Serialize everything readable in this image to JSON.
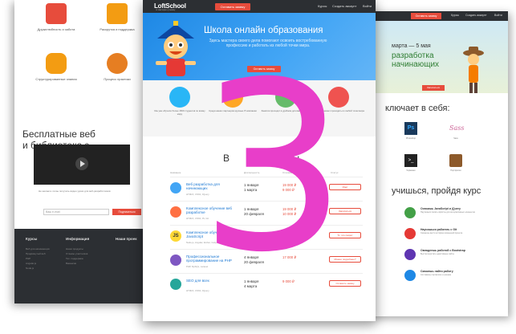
{
  "left_page": {
    "features": [
      {
        "label": "Дружелюбность и забота",
        "icon": "heart-icon",
        "color": "#e74c3c"
      },
      {
        "label": "Раскрутка и поддержка",
        "icon": "sparkle-icon",
        "color": "#f39c12"
      },
      {
        "label": "Структурированные знания",
        "icon": "puzzle-icon",
        "color": "#f39c12"
      },
      {
        "label": "Процесс практики",
        "icon": "chat-icon",
        "color": "#e67e22"
      }
    ],
    "library_title_line1": "Бесплатные веб",
    "library_title_line2": "и библиотека з",
    "subscribe_text": "Не желаете ли вы получать видео уроки для веб-разработчиков",
    "email_placeholder": "Ваш e-mail",
    "subscribe_button": "Подписаться",
    "footer": {
      "col1": "Курсы",
      "col2": "Информация",
      "col3": "Наши проек",
      "col1_links": [
        "Веб для начинающих",
        "Продвинутый веб",
        "PHP",
        "Angular.js",
        "Node.js"
      ],
      "col2_links": [
        "Наши продукты",
        "Отзывы участников",
        "Тех. поддержка",
        "Вакансии"
      ]
    }
  },
  "right_page": {
    "nav_button": "Оставить заявку",
    "nav_links": [
      "Курсы",
      "Создать аккаунт",
      "Войти"
    ],
    "hero_date": "марта — 5 мая",
    "hero_title_line1": "разработка",
    "hero_title_line2": "начинающих",
    "hero_button": "Записаться",
    "includes_title": "ключает в себя:",
    "tech": [
      {
        "name": "ps-icon",
        "label": "Photoshop",
        "color": "#1a3a5c"
      },
      {
        "name": "sass-icon",
        "label": "Sass",
        "color": "#cd6799"
      },
      {
        "name": "terminal-icon",
        "label": "Терминал",
        "color": "#222222"
      },
      {
        "name": "briefcase-icon",
        "label": "Портфолио",
        "color": "#8d5a2b"
      }
    ],
    "learn_title": "учишься, пройдя курс",
    "steps": [
      {
        "title": "Освоишь JavaScript и jQuery",
        "desc": "Научишься писать скрипты для интерактивных элементов",
        "color": "#43a047"
      },
      {
        "title": "Научишься работать с Git",
        "desc": "Сможешь вести историю изменений проекта",
        "color": "#e53935"
      },
      {
        "title": "Овладеешь работой с Bootstrap",
        "desc": "Быстро верстать адаптивные сайты",
        "color": "#5e35b1"
      },
      {
        "title": "Сможешь найти работу",
        "desc": "Составишь портфолио и резюме",
        "color": "#1e88e5"
      }
    ]
  },
  "center_page": {
    "logo": "LoftSchool",
    "logo_sub": "от мастера к ученику",
    "nav_button": "Оставить заявку",
    "nav_links": [
      "Курсы",
      "Создать аккаунт",
      "Войти"
    ],
    "hero_title": "Школа онлайн образования",
    "hero_subtitle": "Здесь мастера своего дела помогают освоить востребованную профессию и работать из любой точки мира.",
    "hero_button": "Оставить заявку",
    "features": [
      {
        "text": "Мы уже обучили более 1500 студентов по всему миру",
        "color": "#29b6f6"
      },
      {
        "text": "Среди наших партнеров крупные IT-компании",
        "color": "#ffa726"
      },
      {
        "text": "Занятия проходят в удобном для вас формате",
        "color": "#66bb6a"
      },
      {
        "text": "Обучение может проходить из любой точки мира",
        "color": "#ef5350"
      }
    ],
    "courses_title": "Ближайшие курсы",
    "courses_title_visible": "В                  урсы",
    "table_headers": [
      "Название",
      "Длительность",
      "Стоимость",
      "Статус"
    ],
    "courses": [
      {
        "name": "Веб разработка для начинающих",
        "stack": "HTML5, CSS3, JQuery",
        "start": "1 января",
        "end": "1 марта",
        "price_old": "19 000 ₽",
        "price_old2": "9 000 ₽",
        "price": "15 000 ₽",
        "price2": "5 000 ₽",
        "status": "Идет",
        "color": "#42a5f5"
      },
      {
        "name": "Комплексное обучение веб разработке",
        "stack": "HTML5, CSS3, JS, Git",
        "start": "1 января",
        "end": "20 февраля",
        "price_old": "19 000 ₽",
        "price_old2": "10 000 ₽",
        "price": "15 000 ₽",
        "price2": "8 000 ₽",
        "status": "Записаться",
        "color": "#ff7043"
      },
      {
        "name": "Комплексное обучение JavaScript",
        "stack": "Node.js, Angular, Ember, Gulp, Backbone, ES2015",
        "start": "1 января",
        "end": "20 февраля",
        "price_old": "15 000 ₽",
        "price_old2": "",
        "price": "15 000 ₽",
        "price2": "",
        "status": "Тс, это секрет",
        "color": "#fdd835"
      },
      {
        "name": "Профессиональное программирование на PHP",
        "stack": "PHP, MySQL, Laravel",
        "start": "4 января",
        "end": "20 февраля",
        "price_old": "17 000 ₽",
        "price_old2": "",
        "price": "15 000 ₽",
        "price2": "",
        "status": "Можно подробнее?",
        "color": "#7e57c2"
      },
      {
        "name": "SEO для всех",
        "stack": "HTML5, CSS3, JQuery",
        "start": "1 января",
        "end": "4 марта",
        "price_old": "9 000 ₽",
        "price_old2": "",
        "price": "7 000 ₽",
        "price2": "",
        "status": "Оставить заявку",
        "color": "#26a69a"
      }
    ]
  },
  "overlay_number": "3"
}
